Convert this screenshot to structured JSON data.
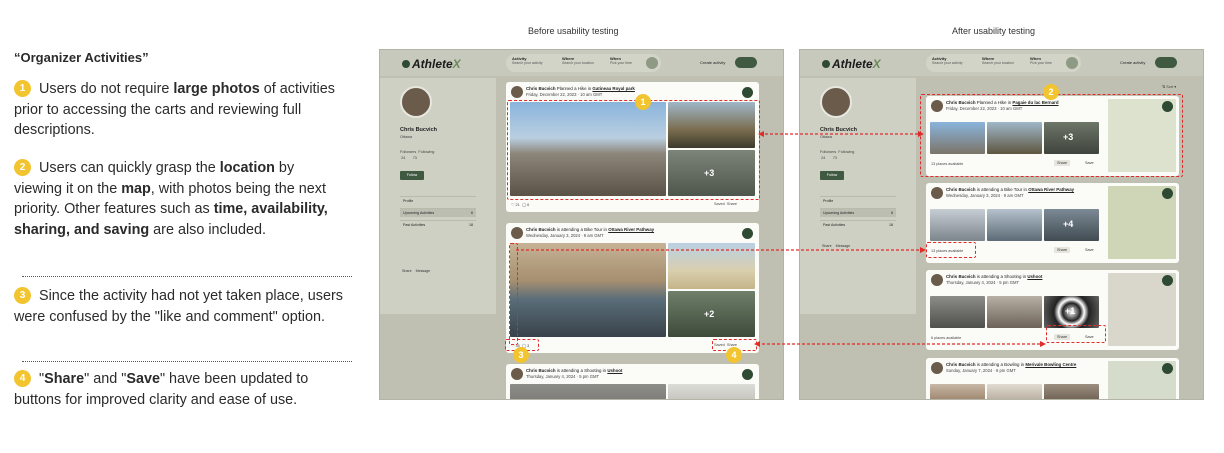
{
  "labels": {
    "before": "Before usability testing",
    "after": "After usability testing"
  },
  "notes": {
    "title": "“Organizer Activities”",
    "items": [
      {
        "num": "1",
        "parts": [
          "Users do not require ",
          "large photos",
          " of activities prior to accessing the carts and reviewing full descriptions."
        ]
      },
      {
        "num": "2",
        "parts": [
          "Users can quickly grasp the ",
          "location",
          " by viewing it on the ",
          "map",
          ", with photos being the next priority. Other features such as ",
          "time, availability, sharing, and saving",
          " are also included."
        ]
      },
      {
        "num": "3",
        "parts": [
          "Since the activity had not yet taken place, users were confused by the \"like and comment\" option."
        ]
      },
      {
        "num": "4",
        "parts": [
          "\"",
          "Share",
          "\" and \"",
          "Save",
          "\" have been updated to buttons for improved clarity and ease of use."
        ]
      }
    ]
  },
  "app": {
    "brand": "Athlete",
    "brand_x": "X",
    "search": [
      {
        "label": "Activity",
        "hint": "Search your activity"
      },
      {
        "label": "Where",
        "hint": "Search your location"
      },
      {
        "label": "When",
        "hint": "Pick your time"
      }
    ],
    "create": "Create activity",
    "profile": {
      "name": "Chris Bucvich",
      "location": "Ottawa",
      "followers_label": "Followers",
      "following_label": "Following",
      "followers": "24",
      "following": "73",
      "follow_btn": "Follow",
      "menu": [
        {
          "label": "Profile",
          "count": ""
        },
        {
          "label": "Upcoming Activities",
          "count": "6"
        },
        {
          "label": "Past Activities",
          "count": "18"
        }
      ],
      "share": "Share",
      "message": "Message"
    },
    "sort": "Sort"
  },
  "before_cards": [
    {
      "user": "Chris Bucvich",
      "verb": "Planned a Hike in",
      "place": "Gatineau Royal park",
      "date": "Friday, December 22, 2023 · 10 am GMT",
      "likes": "21",
      "comments": "6",
      "saved": "Saved",
      "share": "Share"
    },
    {
      "user": "Chris Bucvich",
      "verb": "is attending a Bike Tour in",
      "place": "Ottawa River Pathway",
      "date": "Wednesday, January 3, 2024 · 9 am GMT",
      "likes": "35",
      "comments": "3",
      "saved": "Saved",
      "share": "Share"
    },
    {
      "user": "Chris Bucvich",
      "verb": "is attending a Shooting in",
      "place": "Ushoot",
      "date": "Thursday, January 4, 2024 · 5 pm GMT"
    }
  ],
  "after_cards": [
    {
      "user": "Chris Bucvich",
      "verb": "Planned a Hike in",
      "place": "Pagaie du lac Bernard",
      "date": "Friday, December 22, 2023 · 10 am GMT",
      "avail": "13 places available",
      "share": "Share",
      "save": "Save"
    },
    {
      "user": "Chris Bucvich",
      "verb": "is attending a Bike Tour in",
      "place": "Ottawa River Pathway",
      "date": "Wednesday, January 3, 2024 · 9 am GMT",
      "avail": "13 places available",
      "share": "Share",
      "save": "Save"
    },
    {
      "user": "Chris Bucvich",
      "verb": "is attending a Shooting in",
      "place": "Ushoot",
      "date": "Thursday, January 4, 2024 · 5 pm GMT",
      "avail": "6 places available",
      "share": "Share",
      "save": "Save"
    },
    {
      "user": "Chris Bucvich",
      "verb": "is attending a Bowling in",
      "place": "Merivale Bowling Centre",
      "date": "Sunday, January 7, 2024 · 6 pm GMT"
    }
  ],
  "plus": {
    "b1": "+3",
    "b2": "+2",
    "a1": "+3",
    "a2": "+4",
    "a3": "+1"
  },
  "badges": {
    "b1": "1",
    "a2": "2",
    "b3": "3",
    "b4": "4"
  },
  "colors": {
    "accent": "#e12a2a",
    "badge": "#f2c430",
    "brand": "#2f4a33"
  }
}
